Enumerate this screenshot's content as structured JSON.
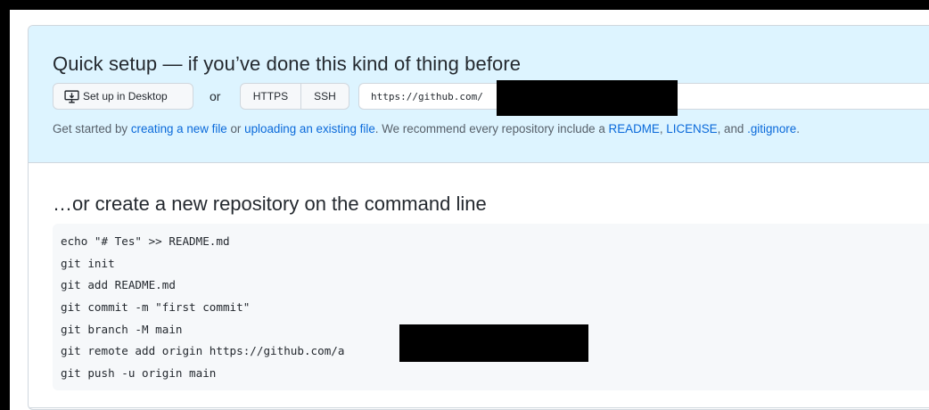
{
  "quick_setup": {
    "title": "Quick setup — if you’ve done this kind of thing before",
    "desktop_button": "Set up in Desktop",
    "or_label": "or",
    "protocols": [
      "HTTPS",
      "SSH"
    ],
    "url_value": "https://github.com/",
    "help": {
      "prefix": "Get started by ",
      "link_new_file": "creating a new file",
      "mid1": " or ",
      "link_upload": "uploading an existing file",
      "mid2": ". We recommend every repository include a ",
      "link_readme": "README",
      "sep1": ", ",
      "link_license": "LICENSE",
      "sep2": ", and ",
      "link_gitignore": ".gitignore",
      "suffix": "."
    }
  },
  "command_line": {
    "title": "…or create a new repository on the command line",
    "lines": [
      "echo \"# Tes\" >> README.md",
      "git init",
      "git add README.md",
      "git commit -m \"first commit\"",
      "git branch -M main",
      "git remote add origin https://github.com/a                      it",
      "git push -u origin main"
    ]
  },
  "colors": {
    "accent_link": "#0969da",
    "quick_setup_bg": "#ddf4ff",
    "code_bg": "#f6f8fa",
    "border": "#d0d7de"
  }
}
